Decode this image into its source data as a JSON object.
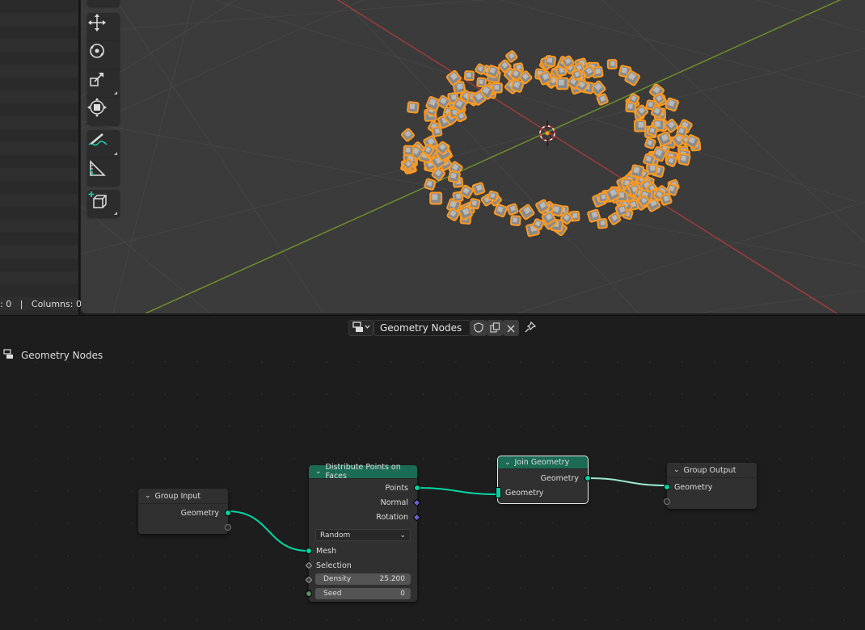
{
  "spreadsheet": {
    "status_text": ": 0   |   Columns: 0"
  },
  "viewport": {
    "tools": [
      "move-icon",
      "rotate-icon",
      "scale-icon",
      "transform-icon",
      "annotate-icon",
      "measure-icon",
      "add-cube-icon"
    ],
    "colors": {
      "background": "#3b3b3b",
      "x_axis": "#9c3c3c",
      "y_axis": "#6a8f2c",
      "selection": "#ff9a1f"
    }
  },
  "node_editor": {
    "header": {
      "editor_type_icon": "node-editor-icon",
      "node_tree_name": "Geometry Nodes",
      "fake_user_icon": "shield-icon",
      "duplicate_icon": "duplicate-icon",
      "unlink_icon": "close-icon",
      "pin_icon": "pin-icon"
    },
    "breadcrumb": {
      "label": "Geometry Nodes"
    },
    "nodes": {
      "group_input": {
        "title": "Group Input",
        "outputs": [
          "Geometry"
        ]
      },
      "distribute": {
        "title": "Distribute Points on Faces",
        "outputs": [
          "Points",
          "Normal",
          "Rotation"
        ],
        "mode": "Random",
        "inputs": {
          "mesh": "Mesh",
          "selection": "Selection"
        },
        "density": {
          "label": "Density",
          "value": "25.200"
        },
        "seed": {
          "label": "Seed",
          "value": "0"
        }
      },
      "join": {
        "title": "Join Geometry",
        "outputs": [
          "Geometry"
        ],
        "inputs": [
          "Geometry"
        ]
      },
      "group_output": {
        "title": "Group Output",
        "inputs": [
          "Geometry"
        ]
      }
    },
    "colors": {
      "header_green": "#1c6b55",
      "link": "#00d6a3",
      "geometry_socket": "#00d6a3"
    }
  }
}
